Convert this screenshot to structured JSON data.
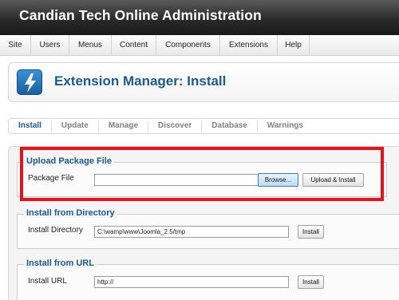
{
  "header": {
    "site_title": "Candian Tech Online Administration"
  },
  "menubar": {
    "items": [
      {
        "label": "Site"
      },
      {
        "label": "Users"
      },
      {
        "label": "Menus"
      },
      {
        "label": "Content"
      },
      {
        "label": "Components"
      },
      {
        "label": "Extensions"
      },
      {
        "label": "Help"
      }
    ]
  },
  "toolbar": {
    "icon": "extension-lightning-icon",
    "page_title": "Extension Manager: Install"
  },
  "subnav": {
    "tabs": [
      {
        "label": "Install",
        "active": true
      },
      {
        "label": "Update"
      },
      {
        "label": "Manage"
      },
      {
        "label": "Discover"
      },
      {
        "label": "Database"
      },
      {
        "label": "Warnings"
      }
    ]
  },
  "upload": {
    "legend": "Upload Package File",
    "field_label": "Package File",
    "value": "",
    "browse_label": "Browse...",
    "submit_label": "Upload & Install"
  },
  "directory": {
    "legend": "Install from Directory",
    "field_label": "Install Directory",
    "value": "C:\\wamp\\www\\Joomla_2.5/tmp",
    "submit_label": "Install"
  },
  "url": {
    "legend": "Install from URL",
    "field_label": "Install URL",
    "value": "http://",
    "submit_label": "Install"
  },
  "colors": {
    "accent": "#1d5a8e",
    "highlight": "#e3131b",
    "header": "#2a2a2a"
  }
}
